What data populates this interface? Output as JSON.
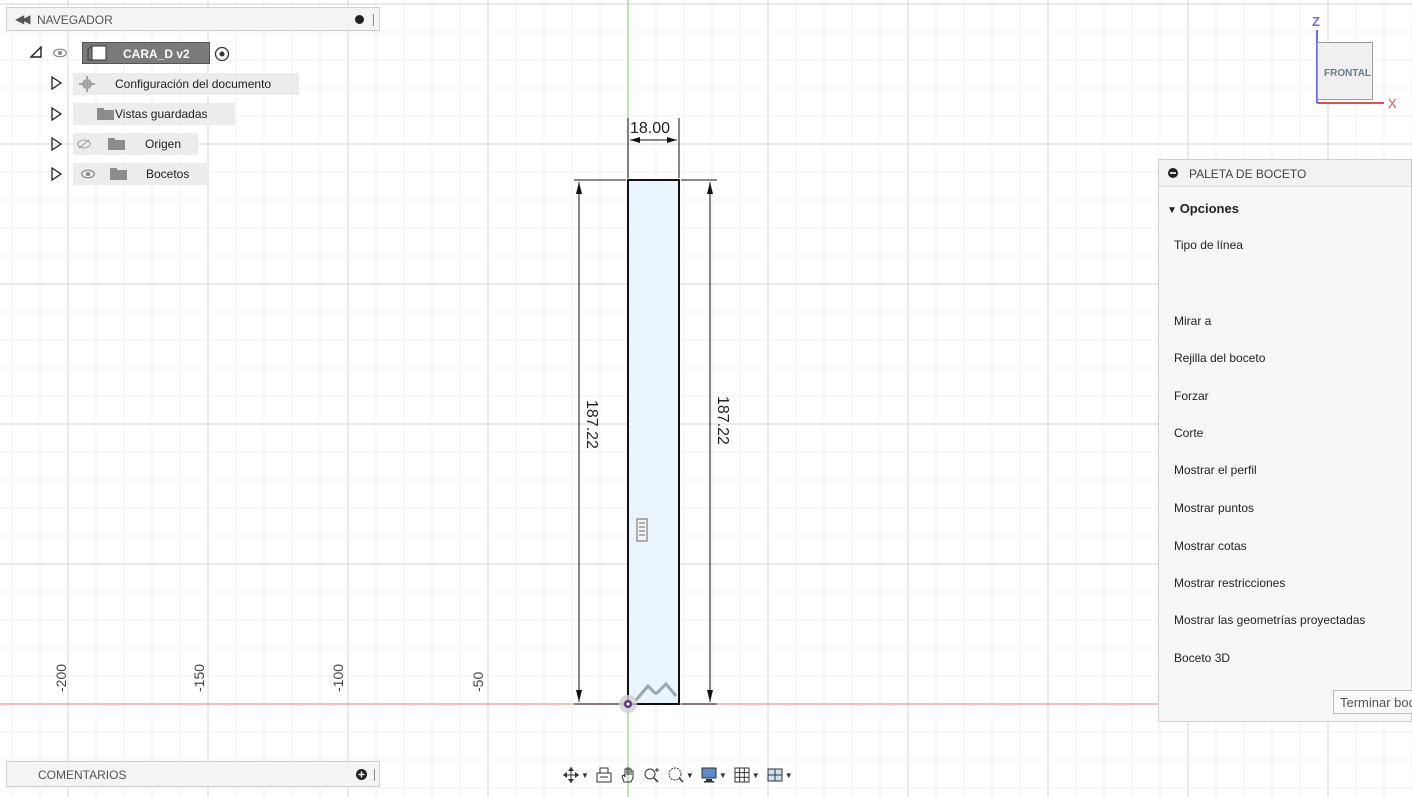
{
  "browser": {
    "title": "NAVEGADOR",
    "root": "CARA_D v2",
    "items": [
      {
        "label": "Configuración del documento"
      },
      {
        "label": "Vistas guardadas"
      },
      {
        "label": "Origen"
      },
      {
        "label": "Bocetos"
      }
    ]
  },
  "viewport": {
    "dimension_width": "18.00",
    "dimension_height_left": "187.22",
    "dimension_height_right": "187.22",
    "axis_labels": [
      "-200",
      "-150",
      "-100",
      "-50"
    ]
  },
  "viewcube": {
    "face": "FRONTAL",
    "axis_z": "Z",
    "axis_x": "X"
  },
  "palette": {
    "title": "PALETA DE BOCETO",
    "section": "Opciones",
    "options": [
      "Tipo de línea",
      "Mirar a",
      "Rejilla del boceto",
      "Forzar",
      "Corte",
      "Mostrar el perfil",
      "Mostrar puntos",
      "Mostrar cotas",
      "Mostrar restricciones",
      "Mostrar las geometrías proyectadas",
      "Boceto 3D"
    ],
    "finish_button": "Terminar boceto"
  },
  "comments": {
    "title": "COMENTARIOS"
  },
  "toolbar": {
    "icons": [
      "orbit-icon",
      "look-at-icon",
      "pan-icon",
      "zoom-icon",
      "fit-icon",
      "display-settings-icon",
      "grid-settings-icon",
      "viewports-icon"
    ]
  },
  "colors": {
    "grid_line": "#e6e6e6",
    "x_axis": "#e99a9a",
    "y_axis": "#8fd18f",
    "sketch_fill": "#eaf4fc",
    "sketch_stroke": "#111111"
  }
}
